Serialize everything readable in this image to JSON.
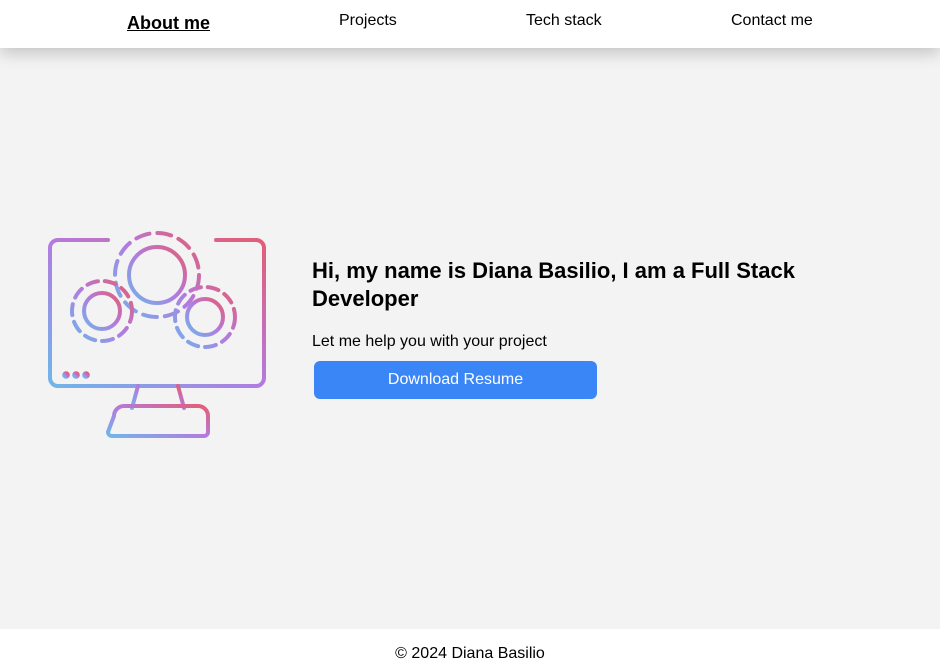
{
  "nav": {
    "items": [
      {
        "label": "About me",
        "active": true
      },
      {
        "label": "Projects",
        "active": false
      },
      {
        "label": "Tech stack",
        "active": false
      },
      {
        "label": "Contact me",
        "active": false
      }
    ]
  },
  "hero": {
    "illustration_icon": "computer-with-gears-icon",
    "gradient_colors": [
      "#c36fd9",
      "#e45d73",
      "#6fb6ea"
    ],
    "title": "Hi, my name is Diana Basilio, I am a Full Stack Developer",
    "subtitle": "Let me help you with your project",
    "download_button_label": "Download Resume",
    "download_button_color": "#3b86f7"
  },
  "footer": {
    "copyright": "© 2024 Diana Basilio"
  }
}
